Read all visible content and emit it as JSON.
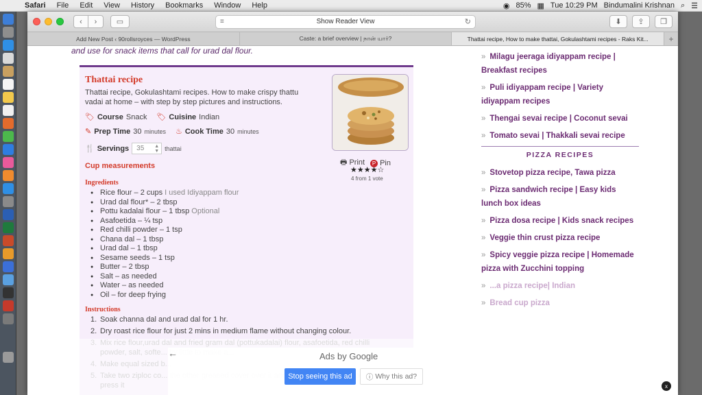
{
  "menubar": {
    "app": "Safari",
    "items": [
      "File",
      "Edit",
      "View",
      "History",
      "Bookmarks",
      "Window",
      "Help"
    ],
    "battery": "85%",
    "clock": "Tue 10:29 PM",
    "user": "Bindumalini Krishnan"
  },
  "toolbar": {
    "url_text": "Show Reader View"
  },
  "tabs": [
    {
      "label": "Add New Post ‹ 90rollsroyces — WordPress"
    },
    {
      "label": "Caste: a brief overview | நான் யார்?"
    },
    {
      "label": "Thattai recipe, How to make thattai, Gokulashtami recipes - Raks Kit..."
    }
  ],
  "page": {
    "intro": "and use for snack items that call for urad dal flour."
  },
  "recipe": {
    "title": "Thattai recipe",
    "description": "Thattai recipe, Gokulashtami recipes. How to make crispy thattu vadai at home – with step by step pictures and instructions.",
    "course_label": "Course",
    "course_value": "Snack",
    "cuisine_label": "Cuisine",
    "cuisine_value": "Indian",
    "prep_label": "Prep Time",
    "prep_value": "30",
    "prep_unit": "minutes",
    "cook_label": "Cook Time",
    "cook_value": "30",
    "cook_unit": "minutes",
    "servings_label": "Servings",
    "servings_value": "35",
    "servings_unit": "thattai",
    "cup_measurements": "Cup measurements",
    "print_label": "Print",
    "pin_label": "Pin",
    "rating_stars": "★★★★☆",
    "rating_text": "4 from 1 vote",
    "ingredients_heading": "Ingredients",
    "ingredients": [
      {
        "text": "Rice flour – 2 cups",
        "note": " I used Idiyappam flour"
      },
      {
        "text": "Urad dal flour* – 2 tbsp",
        "note": ""
      },
      {
        "text": "Pottu kadalai flour – 1 tbsp",
        "note": " Optional"
      },
      {
        "text": "Asafoetida – ¼ tsp",
        "note": ""
      },
      {
        "text": "Red chilli powder – 1 tsp",
        "note": ""
      },
      {
        "text": "Chana dal – 1 tbsp",
        "note": ""
      },
      {
        "text": "Urad dal – 1 tbsp",
        "note": ""
      },
      {
        "text": "Sesame seeds – 1 tsp",
        "note": ""
      },
      {
        "text": "Butter – 2 tbsp",
        "note": ""
      },
      {
        "text": "Salt – as needed",
        "note": ""
      },
      {
        "text": "Water – as needed",
        "note": ""
      },
      {
        "text": "Oil – for deep frying",
        "note": ""
      }
    ],
    "instructions_heading": "Instructions",
    "instructions": [
      {
        "num": "1.",
        "text": "Soak channa dal and urad dal for 1 hr."
      },
      {
        "num": "2.",
        "text": "Dry roast rice flour for just 2 mins in medium flame without changing colour."
      },
      {
        "num": "3.",
        "text": "Mix rice flour,urad dal and fried gram dal (pottukadalai) flour, asafoetida, red chilli powder, salt, softe... by little to make a..."
      },
      {
        "num": "4.",
        "text": "Make equal sized b..."
      },
      {
        "num": "5.",
        "text": "Take two ziploc co... the other greased cover over it and use a flat bottomed bowl to press it"
      }
    ]
  },
  "sidebar": {
    "items_top": [
      "Milagu jeeraga idiyappam recipe | Breakfast recipes",
      "Puli idiyappam recipe | Variety idiyappam recipes",
      "Thengai sevai recipe | Coconut sevai",
      "Tomato sevai | Thakkali sevai recipe"
    ],
    "heading": "PIZZA RECIPES",
    "items_pizza": [
      "Stovetop pizza recipe, Tawa pizza",
      "Pizza sandwich recipe | Easy kids lunch box ideas",
      "Pizza dosa recipe | Kids snack recipes",
      "Veggie thin crust pizza recipe",
      "Spicy veggie pizza recipe | Homemade pizza with Zucchini topping"
    ],
    "items_faded": [
      "...a pizza recipe| Indian",
      "Bread cup pizza"
    ]
  },
  "ad": {
    "title": "Ads by Google",
    "stop_label": "Stop seeing this ad",
    "why_label": "Why this ad?",
    "close": "x"
  }
}
